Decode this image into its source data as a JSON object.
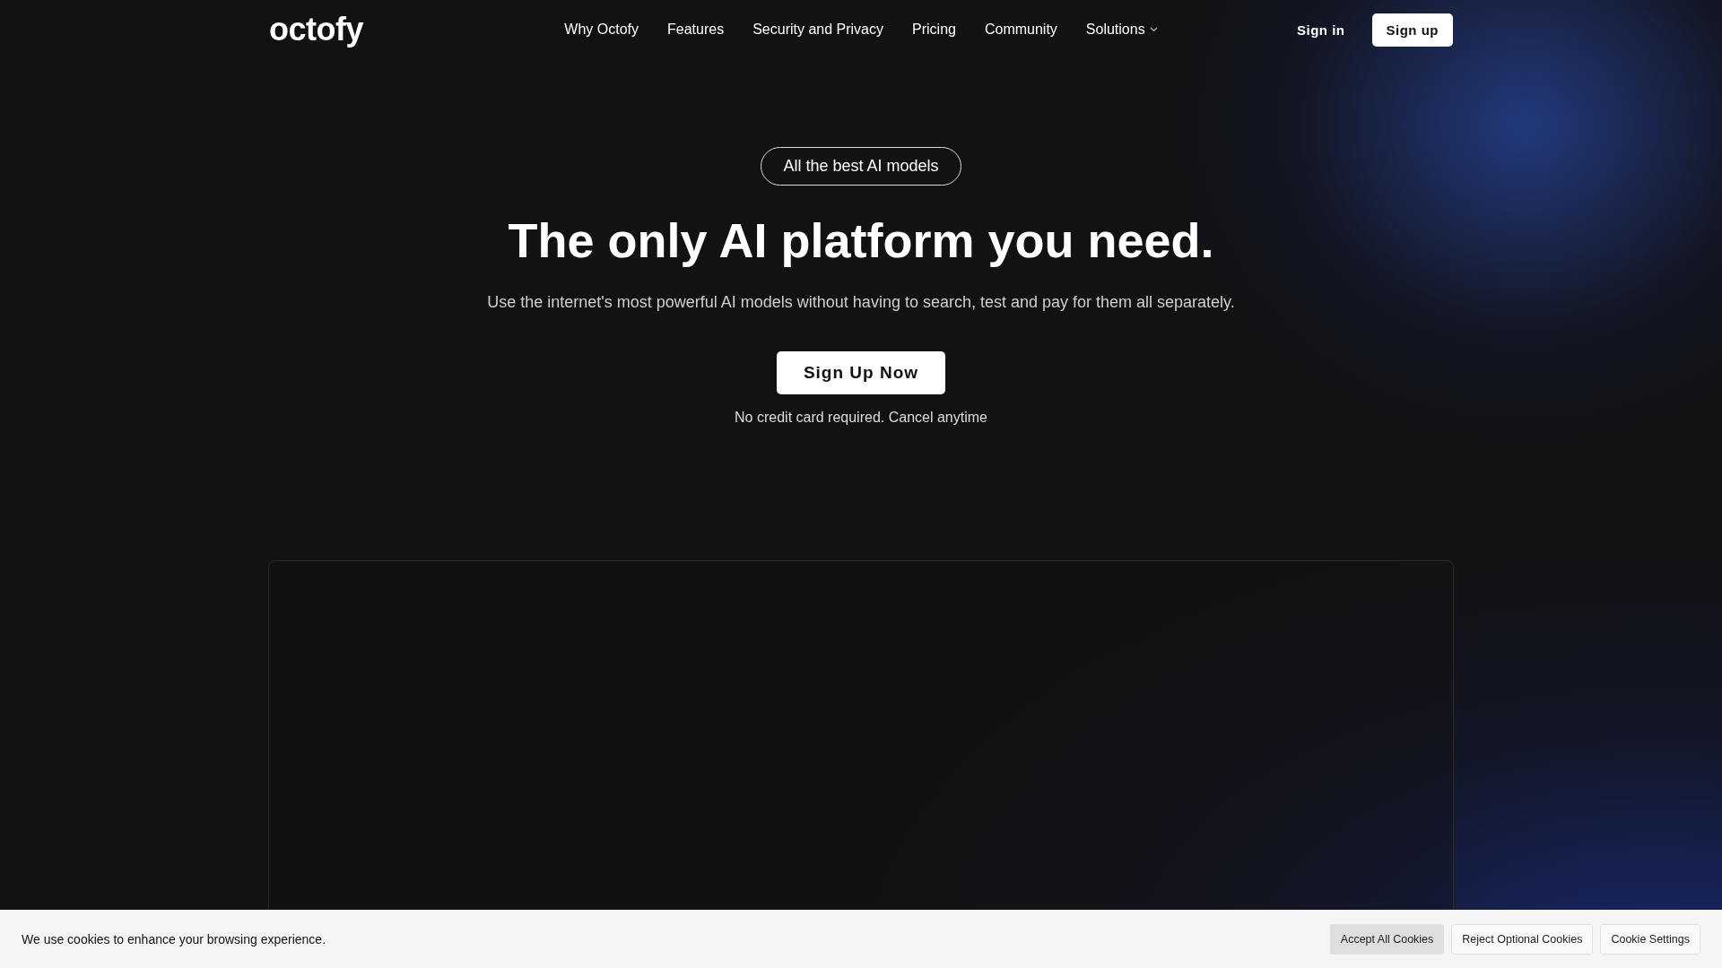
{
  "logo": "octofy",
  "nav": [
    {
      "label": "Why Octofy",
      "dropdown": false
    },
    {
      "label": "Features",
      "dropdown": false
    },
    {
      "label": "Security and Privacy",
      "dropdown": false
    },
    {
      "label": "Pricing",
      "dropdown": false
    },
    {
      "label": "Community",
      "dropdown": false
    },
    {
      "label": "Solutions",
      "dropdown": true
    }
  ],
  "auth": {
    "sign_in": "Sign in",
    "sign_up": "Sign up"
  },
  "hero": {
    "badge": "All the best AI models",
    "title": "The only AI platform you need.",
    "subtitle": "Use the internet's most powerful AI models without having to search, test and pay for them all separately.",
    "cta": "Sign Up Now",
    "note": "No credit card required. Cancel anytime"
  },
  "cookie_bar": {
    "message": "We use cookies to enhance your browsing experience.",
    "buttons": [
      {
        "label": "Accept All Cookies",
        "kind": "primary"
      },
      {
        "label": "Reject Optional Cookies",
        "kind": "outline"
      },
      {
        "label": "Cookie Settings",
        "kind": "outline"
      }
    ]
  }
}
